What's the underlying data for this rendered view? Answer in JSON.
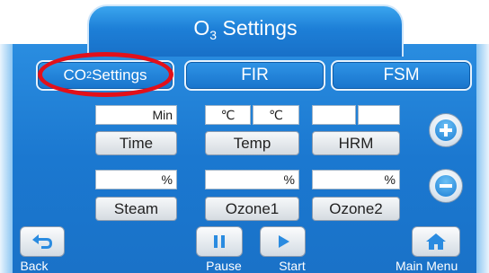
{
  "title": {
    "prefix": "O",
    "sub": "3",
    "suffix": " Settings"
  },
  "tabs": {
    "co2": {
      "prefix": "CO",
      "sub": "2",
      "suffix": " Settings"
    },
    "fir": "FIR",
    "fsm": "FSM"
  },
  "row1": {
    "time_value": "Min",
    "temp_unit_left": "℃",
    "temp_unit_right": "℃",
    "hrm_value_left": "",
    "hrm_value_right": "",
    "time_label": "Time",
    "temp_label": "Temp",
    "hrm_label": "HRM"
  },
  "row2": {
    "steam_value": "%",
    "ozone1_value": "%",
    "ozone2_value": "%",
    "steam_label": "Steam",
    "ozone1_label": "Ozone1",
    "ozone2_label": "Ozone2"
  },
  "bottom": {
    "back_label": "Back",
    "pause_label": "Pause",
    "start_label": "Start",
    "main_menu_label": "Main Menu"
  },
  "icons": {
    "increase": "plus-icon",
    "decrease": "minus-icon",
    "back": "back-arrow-icon",
    "pause": "pause-icon",
    "start": "play-icon",
    "main_menu": "home-icon"
  },
  "colors": {
    "panel_blue": "#1b78d0",
    "highlight_ring": "#e2101a",
    "icon_blue": "#2a8be0"
  }
}
